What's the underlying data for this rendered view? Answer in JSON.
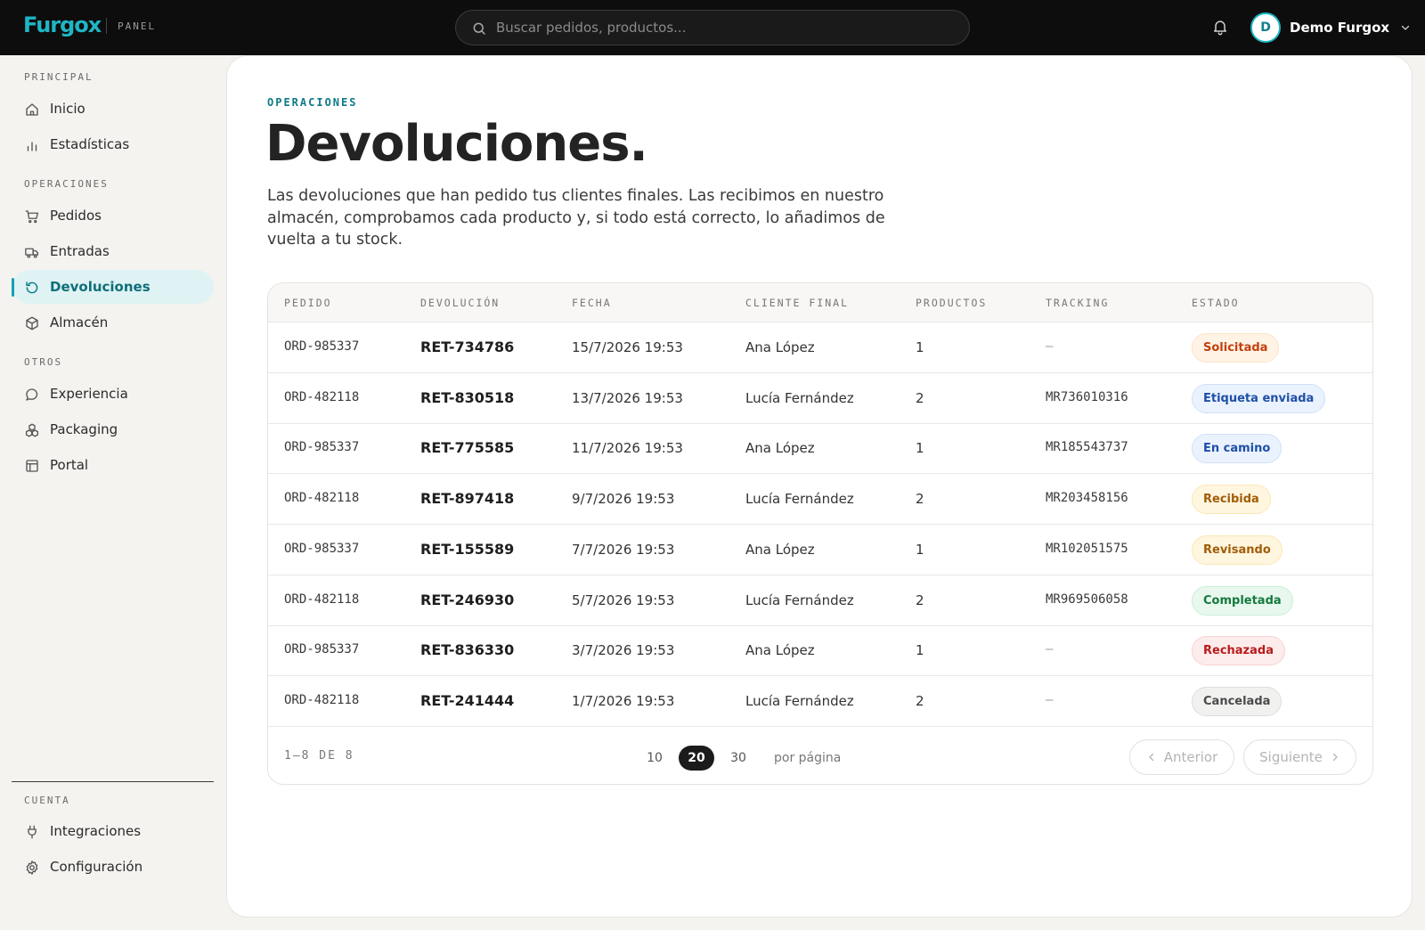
{
  "brand": {
    "logo": "Furgox",
    "tag": "PANEL"
  },
  "search": {
    "placeholder": "Buscar pedidos, productos..."
  },
  "user": {
    "initial": "D",
    "name": "Demo Furgox"
  },
  "sidebar": {
    "sections": [
      "PRINCIPAL",
      "OPERACIONES",
      "OTROS",
      "CUENTA"
    ],
    "items": [
      {
        "label": "Inicio",
        "icon": "home-icon"
      },
      {
        "label": "Estadísticas",
        "icon": "bar-chart-icon"
      },
      {
        "label": "Pedidos",
        "icon": "cart-icon"
      },
      {
        "label": "Entradas",
        "icon": "truck-icon"
      },
      {
        "label": "Devoluciones",
        "icon": "return-icon",
        "active": true
      },
      {
        "label": "Almacén",
        "icon": "box-icon"
      },
      {
        "label": "Experiencia",
        "icon": "chat-bubble-icon"
      },
      {
        "label": "Packaging",
        "icon": "boxes-icon"
      },
      {
        "label": "Portal",
        "icon": "layout-icon"
      },
      {
        "label": "Integraciones",
        "icon": "plug-icon"
      },
      {
        "label": "Configuración",
        "icon": "gear-icon"
      }
    ]
  },
  "page": {
    "eyebrow": "OPERACIONES",
    "title": "Devoluciones.",
    "description": "Las devoluciones que han pedido tus clientes finales. Las recibimos en nuestro almacén, comprobamos cada producto y, si todo está correcto, lo añadimos de vuelta a tu stock."
  },
  "table": {
    "columns": [
      "PEDIDO",
      "DEVOLUCIÓN",
      "FECHA",
      "CLIENTE FINAL",
      "PRODUCTOS",
      "TRACKING",
      "ESTADO"
    ],
    "rows": [
      {
        "pedido": "ORD-985337",
        "devolucion": "RET-734786",
        "fecha": "15/7/2026 19:53",
        "cliente": "Ana López",
        "productos": "1",
        "tracking": "—",
        "estado": "Solicitada"
      },
      {
        "pedido": "ORD-482118",
        "devolucion": "RET-830518",
        "fecha": "13/7/2026 19:53",
        "cliente": "Lucía Fernández",
        "productos": "2",
        "tracking": "MR736010316",
        "estado": "Etiqueta enviada"
      },
      {
        "pedido": "ORD-985337",
        "devolucion": "RET-775585",
        "fecha": "11/7/2026 19:53",
        "cliente": "Ana López",
        "productos": "1",
        "tracking": "MR185543737",
        "estado": "En camino"
      },
      {
        "pedido": "ORD-482118",
        "devolucion": "RET-897418",
        "fecha": "9/7/2026 19:53",
        "cliente": "Lucía Fernández",
        "productos": "2",
        "tracking": "MR203458156",
        "estado": "Recibida"
      },
      {
        "pedido": "ORD-985337",
        "devolucion": "RET-155589",
        "fecha": "7/7/2026 19:53",
        "cliente": "Ana López",
        "productos": "1",
        "tracking": "MR102051575",
        "estado": "Revisando"
      },
      {
        "pedido": "ORD-482118",
        "devolucion": "RET-246930",
        "fecha": "5/7/2026 19:53",
        "cliente": "Lucía Fernández",
        "productos": "2",
        "tracking": "MR969506058",
        "estado": "Completada"
      },
      {
        "pedido": "ORD-985337",
        "devolucion": "RET-836330",
        "fecha": "3/7/2026 19:53",
        "cliente": "Ana López",
        "productos": "1",
        "tracking": "—",
        "estado": "Rechazada"
      },
      {
        "pedido": "ORD-482118",
        "devolucion": "RET-241444",
        "fecha": "1/7/2026 19:53",
        "cliente": "Lucía Fernández",
        "productos": "2",
        "tracking": "—",
        "estado": "Cancelada"
      }
    ]
  },
  "status_colors": {
    "Solicitada": {
      "bg": "#fff3e6",
      "border": "#fde3c6",
      "fg": "#c2410c"
    },
    "Etiqueta enviada": {
      "bg": "#eaf2fd",
      "border": "#cfe0f8",
      "fg": "#1e4fa8"
    },
    "En camino": {
      "bg": "#eaf2fd",
      "border": "#cfe0f8",
      "fg": "#1e4fa8"
    },
    "Recibida": {
      "bg": "#fff6e0",
      "border": "#fbe7b4",
      "fg": "#a15c07"
    },
    "Revisando": {
      "bg": "#fff6e0",
      "border": "#fbe7b4",
      "fg": "#a15c07"
    },
    "Completada": {
      "bg": "#e8f8ee",
      "border": "#c9eed6",
      "fg": "#157a3c"
    },
    "Rechazada": {
      "bg": "#fdecec",
      "border": "#f8d2d2",
      "fg": "#b91c1c"
    },
    "Cancelada": {
      "bg": "#f1f1f0",
      "border": "#dedddb",
      "fg": "#4a4a4a"
    }
  },
  "pagination": {
    "info": "1–8 DE 8",
    "sizes": [
      "10",
      "20",
      "30"
    ],
    "selected_size": "20",
    "per_page_label": "por página",
    "prev_label": "Anterior",
    "next_label": "Siguiente"
  },
  "colors": {
    "accent": "#1fb5c5",
    "topbar": "#0d0d0d",
    "active_bg": "#dff3f4"
  }
}
